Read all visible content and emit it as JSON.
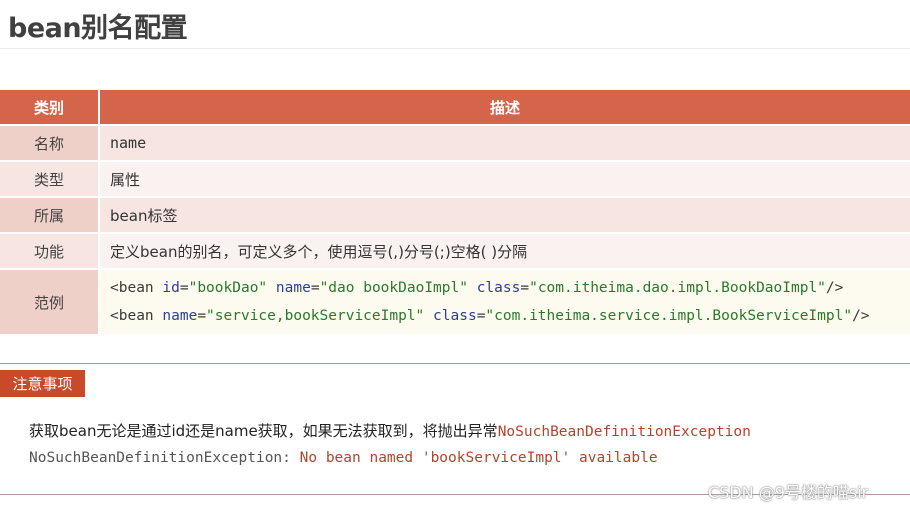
{
  "page": {
    "title": "bean别名配置"
  },
  "table": {
    "headers": {
      "col1": "类别",
      "col2": "描述"
    },
    "rows": [
      {
        "label": "名称",
        "value": "name"
      },
      {
        "label": "类型",
        "value": "属性"
      },
      {
        "label": "所属",
        "value": "bean标签"
      },
      {
        "label": "功能",
        "value": "定义bean的别名，可定义多个，使用逗号(,)分号(;)空格( )分隔"
      }
    ],
    "example": {
      "label": "范例",
      "line1": {
        "open": "<bean ",
        "a1": "id",
        "v1": "\"bookDao\"",
        "a2": "name",
        "v2": "\"dao bookDaoImpl\"",
        "a3": "class",
        "v3": "\"com.itheima.dao.impl.BookDaoImpl\"",
        "close": "/>"
      },
      "line2": {
        "open": "<bean ",
        "a1": "name",
        "v1": "\"service,bookServiceImpl\"",
        "a2": "class",
        "v2": "\"com.itheima.service.impl.BookServiceImpl\"",
        "close": "/>"
      }
    }
  },
  "notice": {
    "label": "注意事项",
    "text_prefix": "获取bean无论是通过id还是name获取，如果无法获取到，将抛出异常",
    "exception_name": "NoSuchBeanDefinitionException",
    "error_class": "NoSuchBeanDefinitionException:",
    "error_message": " No bean named 'bookServiceImpl' available"
  },
  "watermark": "CSDN @9号楼的喵sir"
}
